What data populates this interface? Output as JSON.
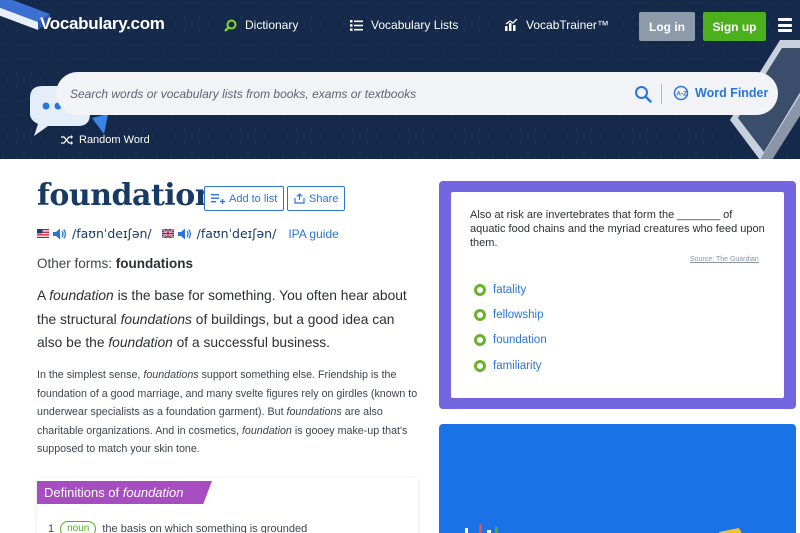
{
  "header": {
    "logo": "Vocabulary.com",
    "nav": [
      {
        "label": "Dictionary",
        "icon": "search-icon"
      },
      {
        "label": "Vocabulary Lists",
        "icon": "list-icon"
      },
      {
        "label": "VocabTrainer™",
        "icon": "chart-icon"
      }
    ],
    "login_label": "Log in",
    "signup_label": "Sign up",
    "menu_icon": "hamburger-icon"
  },
  "search": {
    "placeholder": "Search words or vocabulary lists from books, exams or textbooks",
    "word_finder_label": "Word Finder"
  },
  "random_word_label": "Random Word",
  "word": {
    "title": "foundation",
    "add_to_list_label": "Add to list",
    "share_label": "Share",
    "pron_us": "/faʊnˈdeɪʃən/",
    "pron_uk": "/faʊnˈdeɪʃən/",
    "ipa_guide_label": "IPA guide",
    "other_forms_label": "Other forms:",
    "other_forms_value": "foundations",
    "short_def_parts": [
      "A ",
      "foundation",
      " is the base for something. You often hear about the structural ",
      "foundations",
      " of buildings, but a good idea can also be the ",
      "foundation",
      " of a successful business."
    ],
    "long_def_parts": [
      "In the simplest sense, ",
      "foundations",
      " support something else. Friendship is the foundation of a good marriage, and many svelte figures rely on girdles (known to underwear specialists as a foundation garment). But ",
      "foundations",
      " are also charitable organizations. And in cosmetics, ",
      "foundation",
      " is gooey make-up that's supposed to match your skin tone."
    ],
    "definitions_title_prefix": "Definitions of ",
    "definitions_title_word": "foundation",
    "first_def_number": "1",
    "first_def_pos": "noun",
    "first_def_text": "the basis on which something is grounded"
  },
  "quiz": {
    "sentence": "Also at risk are invertebrates that form the _______ of aquatic food chains and the myriad creatures who feed upon them.",
    "source": "Source: The Guardian",
    "options": [
      "fatality",
      "fellowship",
      "foundation",
      "familiarity"
    ]
  },
  "colors": {
    "header_bg": "#15294a",
    "title": "#173b65",
    "link": "#2a75d6",
    "signup": "#4caf1c",
    "login": "#8c9aaa",
    "quiz_border": "#7466e1",
    "definitions_header": "#a64dc0",
    "ad_bg": "#1a73e6"
  }
}
